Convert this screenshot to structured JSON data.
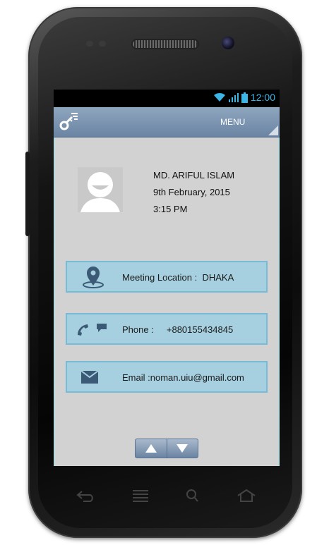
{
  "status_bar": {
    "time": "12:00"
  },
  "top_bar": {
    "menu_label": "MENU"
  },
  "profile": {
    "name": "MD. ARIFUL ISLAM",
    "date": "9th February, 2015",
    "time": "3:15 PM"
  },
  "cards": {
    "location": "Meeting Location :  DHAKA",
    "phone": "Phone :     +880155434845",
    "email": "Email :noman.uiu@gmail.com"
  },
  "colors": {
    "status_icon": "#3db4e6",
    "top_bar": "#7a92b0",
    "card_bg": "#a6cfdf",
    "card_border": "#77bbd6",
    "screen_bg": "#d2d2d2"
  },
  "icons": [
    "wifi-icon",
    "signal-icon",
    "battery-icon",
    "key-menu-icon",
    "avatar-icon",
    "location-pin-icon",
    "phone-icon",
    "chat-icon",
    "mail-icon",
    "up-arrow-icon",
    "down-arrow-icon",
    "back-icon",
    "menu-icon",
    "search-icon",
    "home-icon"
  ]
}
